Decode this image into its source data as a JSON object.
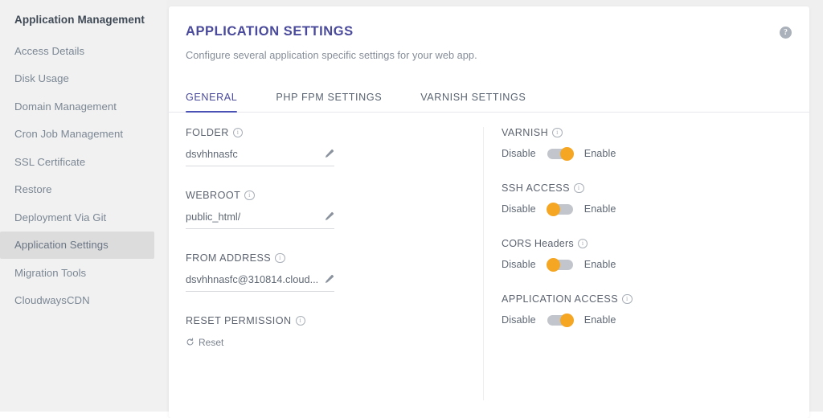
{
  "sidebar": {
    "title": "Application Management",
    "items": [
      {
        "label": "Access Details",
        "active": false
      },
      {
        "label": "Disk Usage",
        "active": false
      },
      {
        "label": "Domain Management",
        "active": false
      },
      {
        "label": "Cron Job Management",
        "active": false
      },
      {
        "label": "SSL Certificate",
        "active": false
      },
      {
        "label": "Restore",
        "active": false
      },
      {
        "label": "Deployment Via Git",
        "active": false
      },
      {
        "label": "Application Settings",
        "active": true
      },
      {
        "label": "Migration Tools",
        "active": false
      },
      {
        "label": "CloudwaysCDN",
        "active": false
      }
    ]
  },
  "card": {
    "title": "APPLICATION SETTINGS",
    "subtitle": "Configure several application specific settings for your web app.",
    "help_icon": "help-circle-icon",
    "help_glyph": "?"
  },
  "tabs": [
    {
      "label": "GENERAL",
      "active": true
    },
    {
      "label": "PHP FPM SETTINGS",
      "active": false
    },
    {
      "label": "VARNISH SETTINGS",
      "active": false
    }
  ],
  "left_fields": [
    {
      "label": "FOLDER",
      "value": "dsvhhnasfc",
      "edit_icon": "pencil-icon"
    },
    {
      "label": "WEBROOT",
      "value": "public_html/",
      "edit_icon": "pencil-icon"
    },
    {
      "label": "FROM ADDRESS",
      "value": "dsvhhnasfc@310814.cloud...",
      "edit_icon": "pencil-icon"
    }
  ],
  "reset_permission": {
    "label": "RESET PERMISSION",
    "action_label": "Reset",
    "action_icon": "refresh-icon"
  },
  "right_toggles": [
    {
      "label": "VARNISH",
      "off_label": "Disable",
      "on_label": "Enable",
      "state": "on"
    },
    {
      "label": "SSH ACCESS",
      "off_label": "Disable",
      "on_label": "Enable",
      "state": "off"
    },
    {
      "label": "CORS Headers",
      "off_label": "Disable",
      "on_label": "Enable",
      "state": "off"
    },
    {
      "label": "APPLICATION ACCESS",
      "off_label": "Disable",
      "on_label": "Enable",
      "state": "on"
    }
  ],
  "colors": {
    "title_accent": "#4a4a9c",
    "tab_underline": "#4a52b5",
    "toggle_knob": "#f5a623",
    "toggle_track": "#c2c6cc",
    "sidebar_bg": "#f1f1f1",
    "sidebar_active_bg": "#dcdcdc",
    "page_bg": "#efefef"
  }
}
